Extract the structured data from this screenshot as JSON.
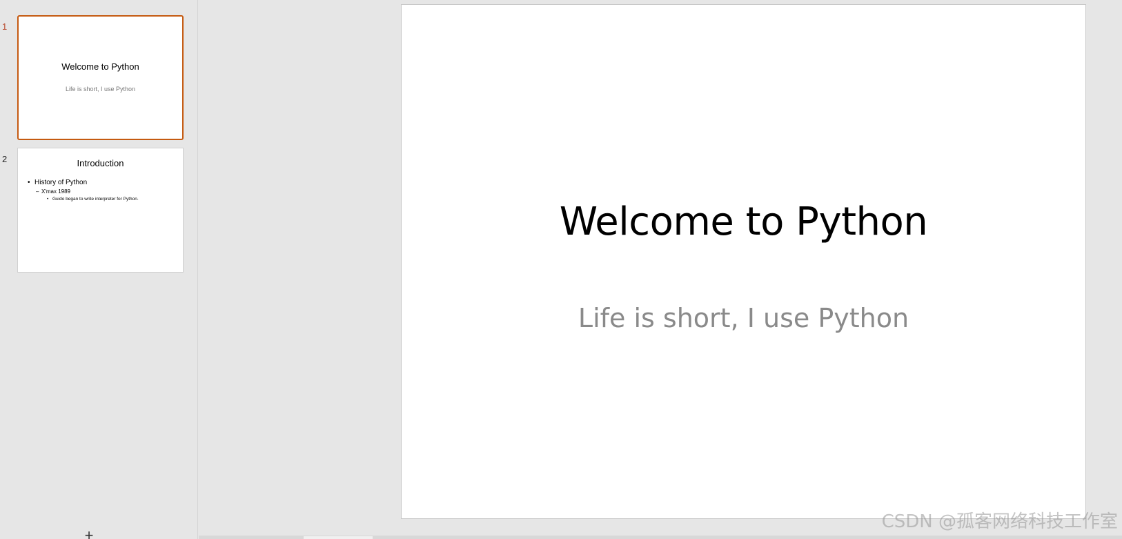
{
  "thumbnails": [
    {
      "number": "1",
      "title": "Welcome to Python",
      "subtitle": "Life is short, I use Python"
    },
    {
      "number": "2",
      "title": "Introduction",
      "bullets": {
        "level1": "History of Python",
        "level2": "X'max 1989",
        "level3": "Guido began to write interpreter for Python."
      }
    }
  ],
  "main_slide": {
    "title": "Welcome to Python",
    "subtitle": "Life is short, I use Python"
  },
  "add_slide_label": "+",
  "watermark": "CSDN @孤客网络科技工作室",
  "colors": {
    "selected_border": "#c55a11",
    "active_number": "#b7472a",
    "subtitle_gray": "#8a8a8a",
    "workspace": "#e6e6e6"
  }
}
